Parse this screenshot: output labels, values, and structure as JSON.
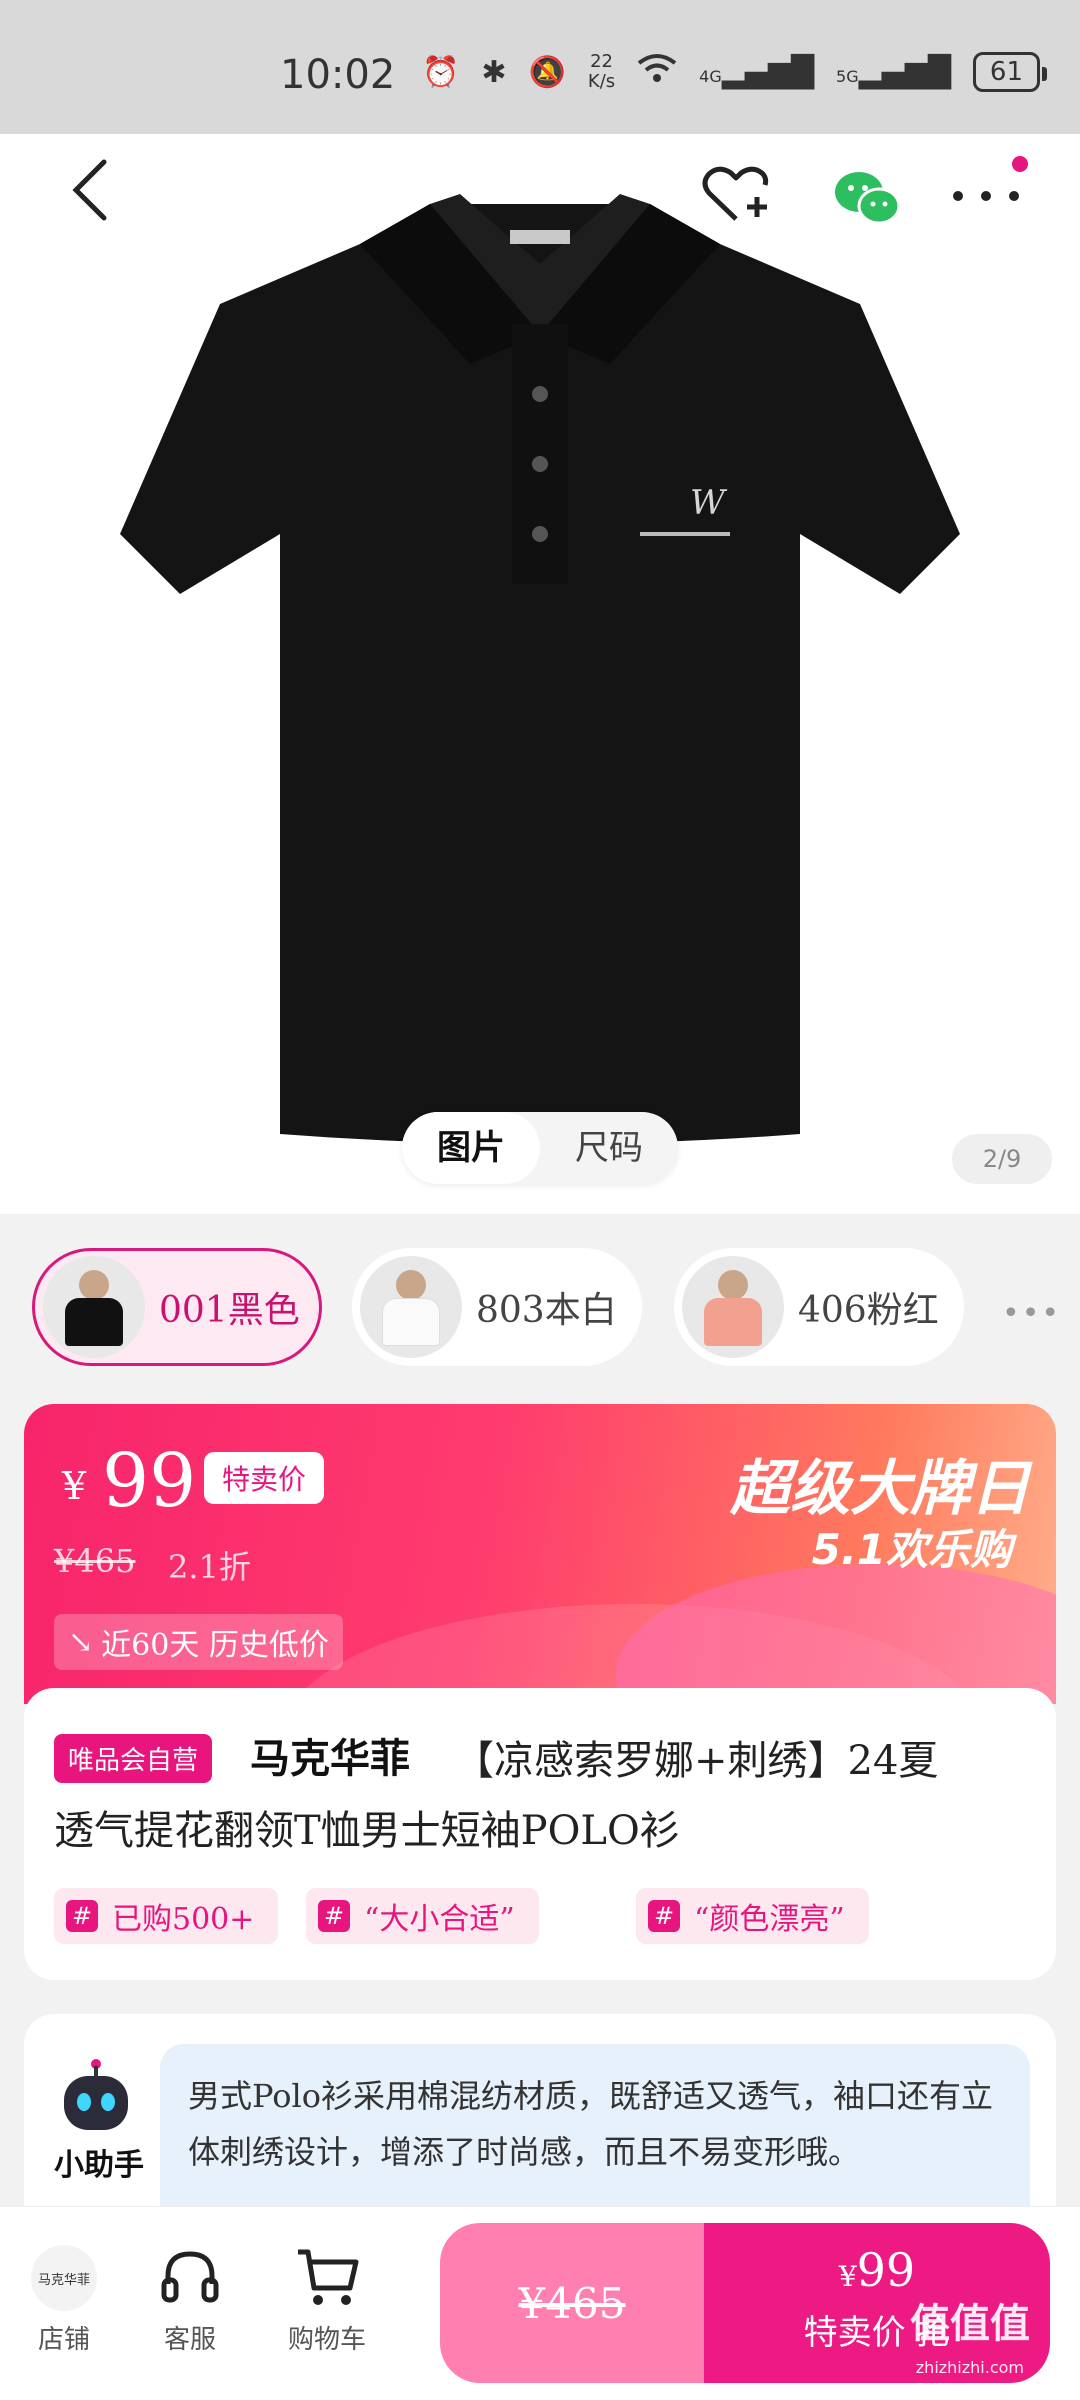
{
  "status_bar": {
    "time": "10:02",
    "net_speed_value": "22",
    "net_speed_unit": "K/s",
    "network_4g": "4G",
    "network_5g": "5G",
    "battery": "61"
  },
  "gallery": {
    "tabs": [
      "图片",
      "尺码"
    ],
    "active_tab": "图片",
    "page_counter": "2/9"
  },
  "swatches": [
    {
      "label": "001黑色",
      "selected": true,
      "shirt_color": "#111111"
    },
    {
      "label": "803本白",
      "selected": false,
      "shirt_color": "#f6f6f6"
    },
    {
      "label": "406粉红",
      "selected": false,
      "shirt_color": "#f2a08f"
    }
  ],
  "price": {
    "currency": "¥",
    "value": "99",
    "tag": "特卖价",
    "original": "¥465",
    "discount": "2.1折",
    "low_price_note": "近60天 历史低价",
    "promo_title": "超级大牌日",
    "promo_subtitle": "5.1欢乐购"
  },
  "product": {
    "self_operated_badge": "唯品会自营",
    "brand": "马克华菲",
    "title_line1": "【凉感索罗娜+刺绣】24夏",
    "title_line2": "透气提花翻领T恤男士短袖POLO衫",
    "tags": [
      "已购500+",
      "“大小合适”",
      "“颜色漂亮”"
    ]
  },
  "assistant": {
    "label": "小助手",
    "text": "男式Polo衫采用棉混纺材质，既舒适又透气，袖口还有立体刺绣设计，增添了时尚感，而且不易变形哦。"
  },
  "bottom_bar": {
    "shop_logo_text": "马克华菲",
    "shop": "店铺",
    "service": "客服",
    "cart": "购物车",
    "original_price": "¥465",
    "special_price_currency": "¥",
    "special_price": "99",
    "special_label": "特卖价 抢",
    "watermark": "值值值",
    "watermark_sub": "zhizhizhi.com"
  },
  "colors": {
    "accent": "#e8157f",
    "buy_light": "#ff7fb0",
    "buy_dark": "#ee1a83"
  }
}
